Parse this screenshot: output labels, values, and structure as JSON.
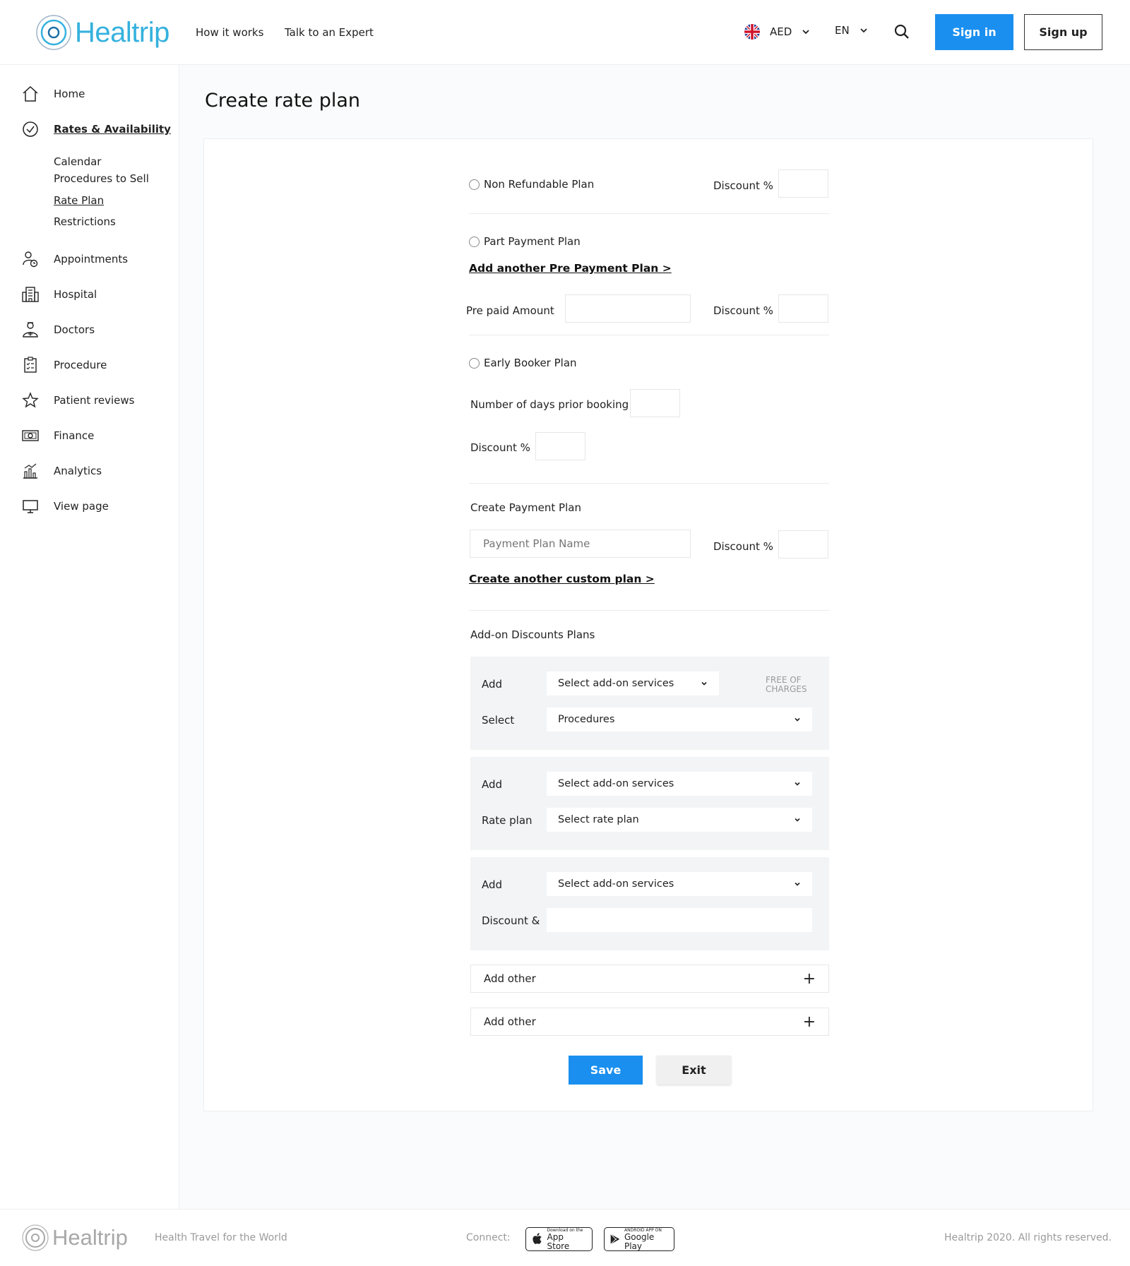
{
  "header": {
    "logo_text": "Healtrip",
    "nav": [
      "How it works",
      "Talk to an Expert"
    ],
    "currency": "AED",
    "language": "EN",
    "sign_in": "Sign in",
    "sign_up": "Sign up"
  },
  "sidebar": {
    "items": [
      {
        "label": "Home",
        "icon": "home-icon"
      },
      {
        "label": "Rates & Availability",
        "icon": "check-circle-icon"
      },
      {
        "label": "Appointments",
        "icon": "user-clock-icon"
      },
      {
        "label": "Hospital",
        "icon": "building-icon"
      },
      {
        "label": "Doctors",
        "icon": "doctor-icon"
      },
      {
        "label": "Procedure",
        "icon": "clipboard-icon"
      },
      {
        "label": "Patient reviews",
        "icon": "star-icon"
      },
      {
        "label": "Finance",
        "icon": "money-icon"
      },
      {
        "label": "Analytics",
        "icon": "chart-icon"
      },
      {
        "label": "View page",
        "icon": "monitor-icon"
      }
    ],
    "sub_items": [
      "Calendar",
      "Procedures to Sell",
      "Rate Plan",
      "Restrictions"
    ]
  },
  "main": {
    "title": "Create rate plan",
    "non_refundable": "Non Refundable Plan",
    "discount_pct": "Discount %",
    "part_payment": "Part Payment Plan",
    "add_pre_payment": "Add another Pre Payment Plan >",
    "pre_paid_amount": "Pre paid Amount",
    "early_booker": "Early Booker Plan",
    "days_prior": "Number of days prior booking",
    "create_payment_plan": "Create Payment Plan",
    "payment_plan_name": "Payment Plan Name",
    "create_custom_plan": "Create another custom plan >",
    "addon_title": "Add-on Discounts Plans",
    "addon_blocks": [
      {
        "label1": "Add",
        "select1": "Select add-on services",
        "free": "FREE OF CHARGES",
        "label2": "Select",
        "select2": "Procedures"
      },
      {
        "label1": "Add",
        "select1": "Select add-on services",
        "label2": "Rate plan",
        "select2": "Select rate plan"
      },
      {
        "label1": "Add",
        "select1": "Select add-on services",
        "label2": "Discount &"
      }
    ],
    "add_other": "Add other",
    "save": "Save",
    "exit": "Exit"
  },
  "footer": {
    "logo_text": "Healtrip",
    "tagline": "Health Travel for the World",
    "connect": "Connect:",
    "app_store_small": "Download on the",
    "app_store": "App Store",
    "google_small": "ANDROID APP ON",
    "google_play": "Google Play",
    "copyright": "Healtrip 2020. All rights reserved."
  }
}
